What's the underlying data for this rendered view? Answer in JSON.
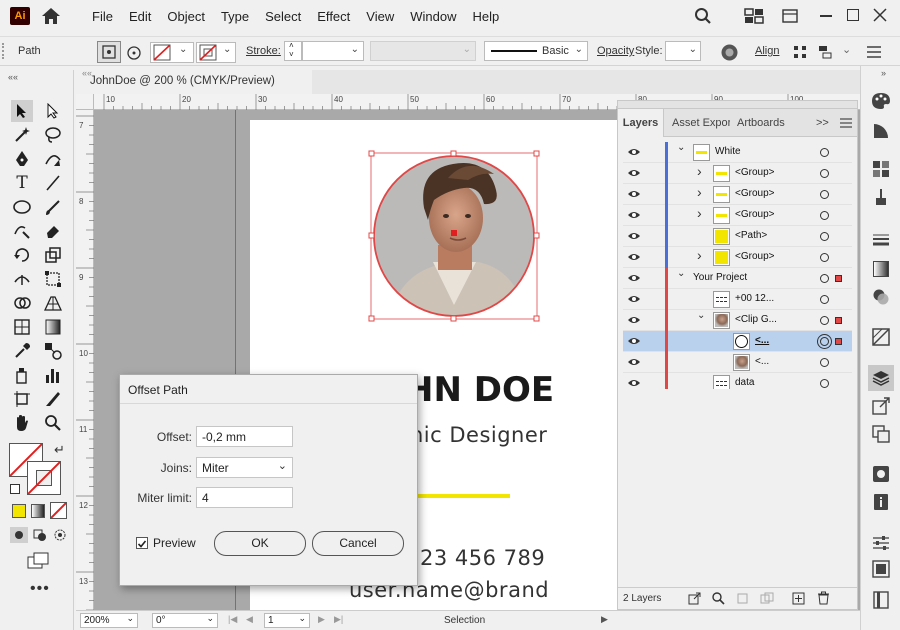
{
  "app": {
    "logo": "Ai"
  },
  "menu": [
    "File",
    "Edit",
    "Object",
    "Type",
    "Select",
    "Effect",
    "View",
    "Window",
    "Help"
  ],
  "control_bar": {
    "selection_type": "Path",
    "stroke_label": "Stroke:",
    "brush_label": "Basic",
    "opacity_label": "Opacity",
    "style_label": "Style:",
    "align_label": "Align"
  },
  "document": {
    "tab_title": "JohnDoe  @ 200 % (CMYK/Preview)"
  },
  "ruler": {
    "h_ticks": [
      "10",
      "20",
      "30",
      "40",
      "50",
      "60",
      "70",
      "80",
      "90",
      "100"
    ],
    "v_ticks": [
      "7",
      "8",
      "9",
      "10",
      "11",
      "12",
      "13"
    ]
  },
  "artboard": {
    "name_visible": "HN DOE",
    "role_visible": "hic Designer",
    "phone_visible": "23 456 789",
    "email_visible": "user.name@brand"
  },
  "layers_panel": {
    "tabs": [
      "Layers",
      "Asset Expor",
      "Artboards"
    ],
    "more": ">>",
    "rows": [
      {
        "name": "White",
        "indent": 0,
        "chevron": "v",
        "color": "#4a6fd6",
        "thumb": "yellow-bar"
      },
      {
        "name": "<Group>",
        "indent": 1,
        "chevron": ">",
        "color": "#4a6fd6",
        "thumb": "yellow-bar"
      },
      {
        "name": "<Group>",
        "indent": 1,
        "chevron": ">",
        "color": "#4a6fd6",
        "thumb": "yellow-bar"
      },
      {
        "name": "<Group>",
        "indent": 1,
        "chevron": ">",
        "color": "#4a6fd6",
        "thumb": "yellow-bar"
      },
      {
        "name": "<Path>",
        "indent": 1,
        "chevron": "",
        "color": "#4a6fd6",
        "thumb": "yellow-fill"
      },
      {
        "name": "<Group>",
        "indent": 1,
        "chevron": ">",
        "color": "#4a6fd6",
        "thumb": "yellow-fill"
      },
      {
        "name": "Your Project",
        "indent": 0,
        "chevron": "v",
        "color": "#e04848",
        "thumb": ""
      },
      {
        "name": "+00 12...",
        "indent": 1,
        "chevron": "",
        "color": "#e04848",
        "thumb": "text"
      },
      {
        "name": "<Clip G...",
        "indent": 1,
        "chevron": "v",
        "color": "#e04848",
        "thumb": "photo"
      },
      {
        "name": "<...",
        "indent": 2,
        "chevron": "",
        "color": "#e04848",
        "thumb": "circle",
        "selected": true
      },
      {
        "name": "<...",
        "indent": 2,
        "chevron": "",
        "color": "#e04848",
        "thumb": "photo"
      },
      {
        "name": "data",
        "indent": 1,
        "chevron": "",
        "color": "#e04848",
        "thumb": "text"
      }
    ],
    "footer_count": "2 Layers"
  },
  "status_bar": {
    "zoom": "200%",
    "rotation": "0°",
    "artboard_num": "1",
    "mode": "Selection"
  },
  "dialog": {
    "title": "Offset Path",
    "offset_label": "Offset:",
    "offset_value": "-0,2 mm",
    "joins_label": "Joins:",
    "joins_value": "Miter",
    "miter_label": "Miter limit:",
    "miter_value": "4",
    "preview_label": "Preview",
    "preview_checked": true,
    "ok_label": "OK",
    "cancel_label": "Cancel"
  },
  "colors": {
    "layer_blue": "#4a6fd6",
    "layer_red": "#e04848",
    "accent_yellow": "#f2e600",
    "selection_row": "#b9d1ec"
  }
}
